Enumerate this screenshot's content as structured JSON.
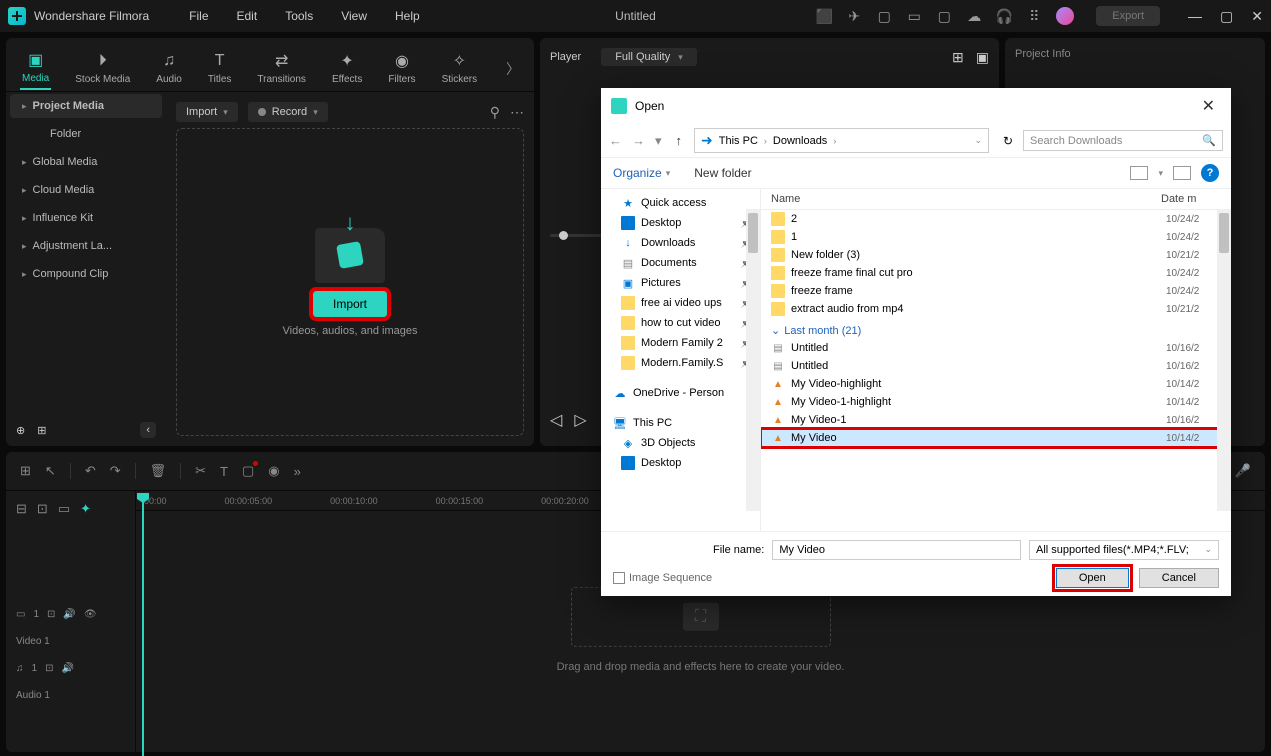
{
  "app_name": "Wondershare Filmora",
  "menu": [
    "File",
    "Edit",
    "Tools",
    "View",
    "Help"
  ],
  "document_title": "Untitled",
  "export_label": "Export",
  "tabs": [
    {
      "label": "Media",
      "active": true
    },
    {
      "label": "Stock Media"
    },
    {
      "label": "Audio"
    },
    {
      "label": "Titles"
    },
    {
      "label": "Transitions"
    },
    {
      "label": "Effects"
    },
    {
      "label": "Filters"
    },
    {
      "label": "Stickers"
    }
  ],
  "import_dd": "Import",
  "record_dd": "Record",
  "sidebar": {
    "items": [
      {
        "label": "Project Media",
        "active": true
      },
      {
        "label": "Folder",
        "plain": true
      },
      {
        "label": "Global Media"
      },
      {
        "label": "Cloud Media"
      },
      {
        "label": "Influence Kit"
      },
      {
        "label": "Adjustment La..."
      },
      {
        "label": "Compound Clip"
      }
    ]
  },
  "import_button": "Import",
  "import_caption": "Videos, audios, and images",
  "player": {
    "title": "Player",
    "quality": "Full Quality"
  },
  "project_info": "Project Info",
  "ruler": [
    "00:00",
    "00:00:05:00",
    "00:00:10:00",
    "00:00:15:00",
    "00:00:20:00"
  ],
  "tracks": {
    "video": "Video 1",
    "audio": "Audio 1"
  },
  "timeline_drop": "Drag and drop media and effects here to create your video.",
  "dialog": {
    "title": "Open",
    "breadcrumb": [
      "This PC",
      "Downloads"
    ],
    "search_placeholder": "Search Downloads",
    "organize": "Organize",
    "new_folder": "New folder",
    "tree": [
      {
        "label": "Quick access",
        "ico": "star"
      },
      {
        "label": "Desktop",
        "ico": "dsk",
        "pin": true
      },
      {
        "label": "Downloads",
        "ico": "dl",
        "pin": true
      },
      {
        "label": "Documents",
        "ico": "doc",
        "pin": true
      },
      {
        "label": "Pictures",
        "ico": "pic",
        "pin": true
      },
      {
        "label": "free ai video ups",
        "ico": "fld",
        "pin": true
      },
      {
        "label": "how to cut video",
        "ico": "fld",
        "pin": true
      },
      {
        "label": "Modern Family 2",
        "ico": "fld",
        "pin": true
      },
      {
        "label": "Modern.Family.S",
        "ico": "fld",
        "pin": true
      },
      {
        "label": "OneDrive - Person",
        "ico": "cloud",
        "spaced": true
      },
      {
        "label": "This PC",
        "ico": "pc",
        "spaced": true
      },
      {
        "label": "3D Objects",
        "ico": "obj"
      },
      {
        "label": "Desktop",
        "ico": "dsk"
      }
    ],
    "columns": {
      "name": "Name",
      "date": "Date m"
    },
    "files_current": [
      {
        "name": "2",
        "ico": "fld",
        "date": "10/24/2"
      },
      {
        "name": "1",
        "ico": "fld",
        "date": "10/24/2"
      },
      {
        "name": "New folder (3)",
        "ico": "fld",
        "date": "10/21/2"
      },
      {
        "name": "freeze frame final cut pro",
        "ico": "fld",
        "date": "10/24/2"
      },
      {
        "name": "freeze frame",
        "ico": "fld",
        "date": "10/24/2"
      },
      {
        "name": "extract audio from mp4",
        "ico": "fld",
        "date": "10/21/2"
      }
    ],
    "group": "Last month (21)",
    "files_last": [
      {
        "name": "Untitled",
        "ico": "doc",
        "date": "10/16/2"
      },
      {
        "name": "Untitled",
        "ico": "doc",
        "date": "10/16/2"
      },
      {
        "name": "My Video-highlight",
        "ico": "vid",
        "date": "10/14/2"
      },
      {
        "name": "My Video-1-highlight",
        "ico": "vid",
        "date": "10/14/2"
      },
      {
        "name": "My Video-1",
        "ico": "vid",
        "date": "10/16/2"
      },
      {
        "name": "My Video",
        "ico": "vid",
        "date": "10/14/2",
        "selected": true
      }
    ],
    "filename_label": "File name:",
    "filename_value": "My Video",
    "filetype": "All supported files(*.MP4;*.FLV;",
    "image_sequence": "Image Sequence",
    "open_btn": "Open",
    "cancel_btn": "Cancel"
  }
}
